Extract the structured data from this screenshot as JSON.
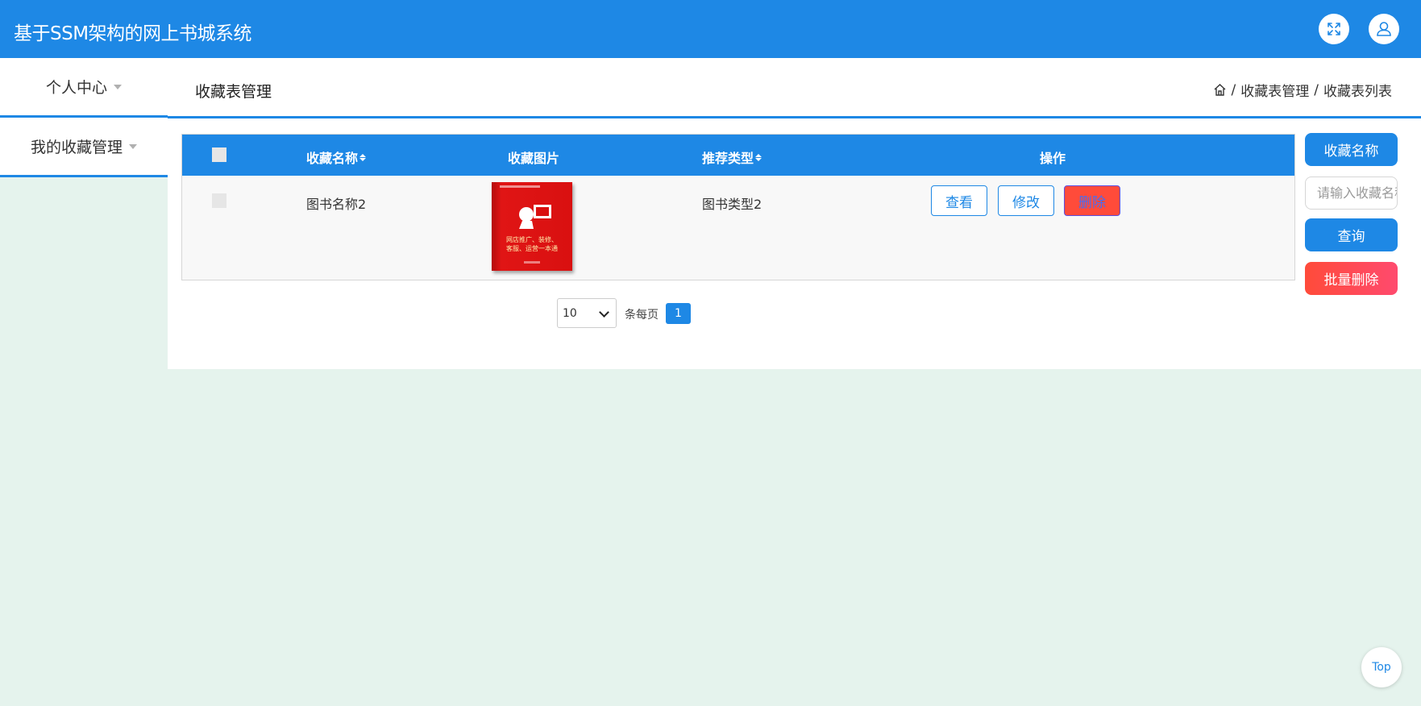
{
  "app": {
    "title": "基于SSM架构的网上书城系统"
  },
  "header": {
    "fullscreen_icon": "expand-icon",
    "user_icon": "user-icon"
  },
  "sidebar": {
    "items": [
      {
        "label": "个人中心"
      },
      {
        "label": "我的收藏管理"
      }
    ]
  },
  "page": {
    "title": "收藏表管理",
    "breadcrumb": [
      "收藏表管理",
      "收藏表列表"
    ],
    "breadcrumb_separator": "/",
    "home_icon": "home-icon"
  },
  "table": {
    "columns": [
      "收藏名称",
      "收藏图片",
      "推荐类型",
      "操作"
    ],
    "rows": [
      {
        "name": "图书名称2",
        "type": "图书类型2",
        "image_text_lines": [
          "网店推广、装修、",
          "客服、运营一本通"
        ],
        "actions": [
          "查看",
          "修改",
          "删除"
        ]
      }
    ]
  },
  "pagination": {
    "page_size": "10",
    "per_page_label": "条每页",
    "current_page": "1"
  },
  "search": {
    "label_button": "收藏名称",
    "placeholder": "请输入收藏名称",
    "query_button": "查询",
    "batch_delete_button": "批量删除"
  },
  "top_button": "Top",
  "colors": {
    "primary": "#1e88e5",
    "danger": "#ff4b3a",
    "background": "#e5f3ed"
  }
}
